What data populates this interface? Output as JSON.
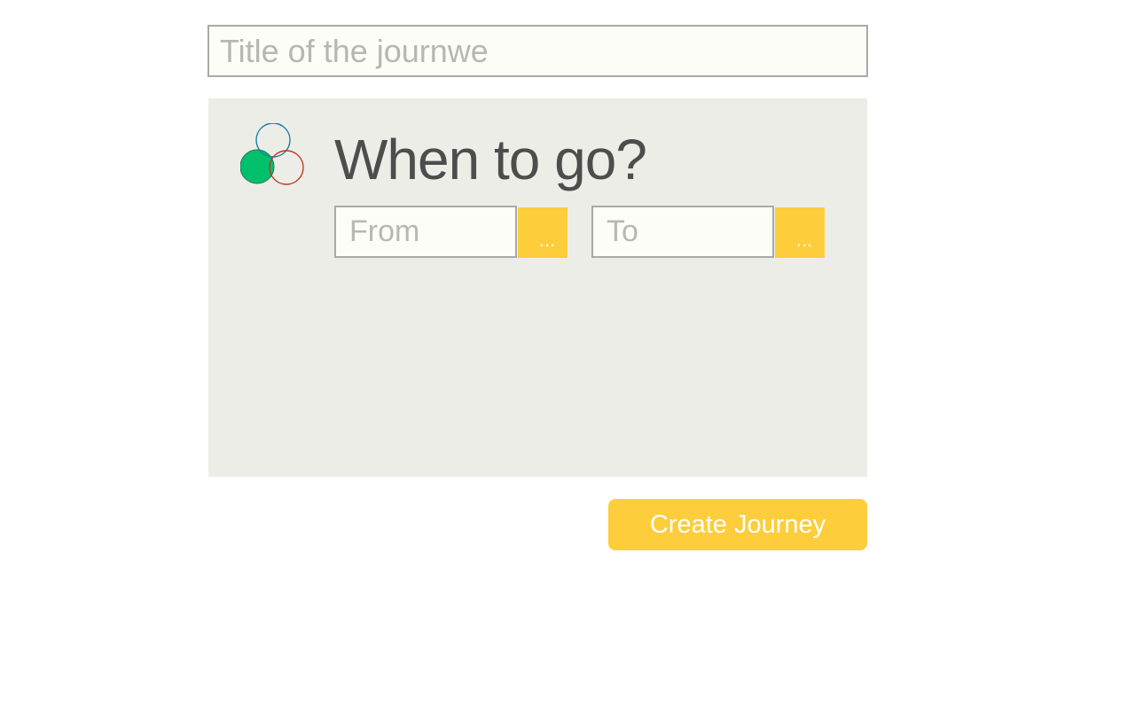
{
  "form": {
    "title_placeholder": "Title of the journwe",
    "title_value": ""
  },
  "when_panel": {
    "logo_icon": "three-circles-logo-icon",
    "colors": {
      "logo_green": "#00c06b",
      "logo_blue": "#1b7fa3",
      "logo_red": "#c83426",
      "panel_background": "#edede8",
      "accent": "#fdcd3b"
    },
    "heading": "When to go?",
    "from_placeholder": "From",
    "from_value": "",
    "from_picker_label": "...",
    "to_placeholder": "To",
    "to_value": "",
    "to_picker_label": "..."
  },
  "actions": {
    "create_label": "Create Journey"
  }
}
